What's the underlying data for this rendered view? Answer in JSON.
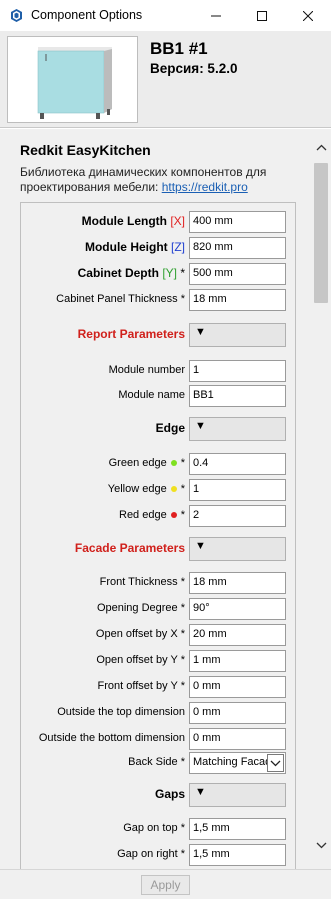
{
  "window": {
    "title": "Component Options",
    "icons": [
      "sketchup-app-icon",
      "minimize-icon",
      "maximize-icon",
      "close-icon"
    ]
  },
  "header": {
    "module_title": "BB1 #1",
    "version": "Версия: 5.2.0"
  },
  "intro": {
    "brand": "Redkit EasyKitchen",
    "description": "Библиотека динамических компонентов для проектирования мебели: ",
    "link": "https://redkit.pro"
  },
  "fields": {
    "module_length": {
      "label": "Module Length",
      "axis": "[X]",
      "value": "400 mm"
    },
    "module_height": {
      "label": "Module Height",
      "axis": "[Z]",
      "value": "820 mm"
    },
    "cabinet_depth": {
      "label": "Cabinet Depth",
      "axis": "[Y]",
      "req": "*",
      "value": "500 mm"
    },
    "panel_thickness": {
      "label": "Cabinet Panel Thickness *",
      "value": "18 mm"
    },
    "report_section": {
      "label": "Report Parameters",
      "toggle": "▼"
    },
    "module_number": {
      "label": "Module number",
      "value": "1"
    },
    "module_name": {
      "label": "Module name",
      "value": "BB1"
    },
    "edge_section": {
      "label": "Edge",
      "toggle": "▼"
    },
    "green_edge": {
      "label": "Green edge",
      "req": "*",
      "value": "0.4"
    },
    "yellow_edge": {
      "label": "Yellow edge",
      "req": "*",
      "value": "1"
    },
    "red_edge": {
      "label": "Red edge",
      "req": "*",
      "value": "2"
    },
    "facade_section": {
      "label": "Facade Parameters",
      "toggle": "▼"
    },
    "front_thickness": {
      "label": "Front Thickness *",
      "value": "18 mm"
    },
    "opening_degree": {
      "label": "Opening Degree *",
      "value": "90°"
    },
    "open_offset_x": {
      "label": "Open offset by X *",
      "value": "20 mm"
    },
    "open_offset_y": {
      "label": "Open offset by Y *",
      "value": "1 mm"
    },
    "front_offset_y": {
      "label": "Front offset by Y *",
      "value": "0 mm"
    },
    "outside_top": {
      "label": "Outside the top dimension",
      "value": "0 mm"
    },
    "outside_bottom": {
      "label": "Outside the bottom dimension",
      "value": "0 mm"
    },
    "back_side": {
      "label": "Back Side *",
      "value": "Matching Facade"
    },
    "gaps_section": {
      "label": "Gaps",
      "toggle": "▼"
    },
    "gap_top": {
      "label": "Gap on top *",
      "value": "1,5 mm"
    },
    "gap_right": {
      "label": "Gap on right *",
      "value": "1,5 mm"
    }
  },
  "colors": {
    "green_dot": "#7fe020",
    "yellow_dot": "#f0e020",
    "red_dot": "#e02020",
    "section_red": "#d0201b"
  },
  "footer": {
    "apply_label": "Apply"
  }
}
